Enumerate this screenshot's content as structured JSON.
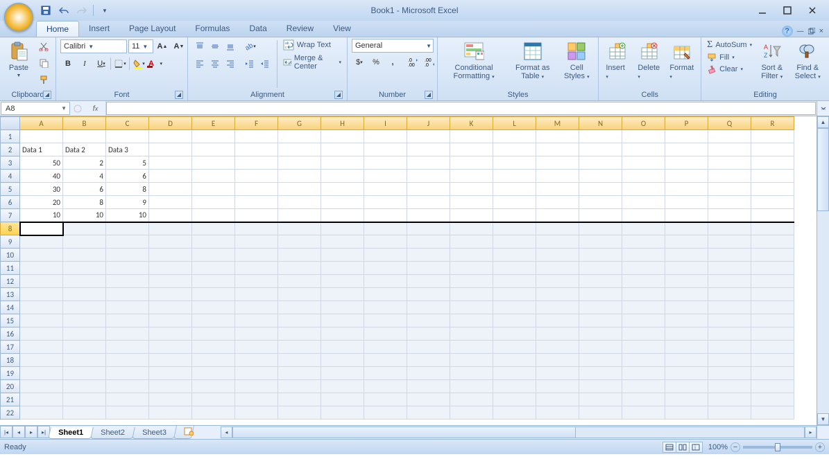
{
  "window": {
    "title": "Book1 - Microsoft Excel"
  },
  "tabs": [
    "Home",
    "Insert",
    "Page Layout",
    "Formulas",
    "Data",
    "Review",
    "View"
  ],
  "active_tab": "Home",
  "ribbon": {
    "clipboard": {
      "label": "Clipboard",
      "paste": "Paste"
    },
    "font": {
      "label": "Font",
      "name": "Calibri",
      "size": "11"
    },
    "alignment": {
      "label": "Alignment",
      "wrap": "Wrap Text",
      "merge": "Merge & Center"
    },
    "number": {
      "label": "Number",
      "format": "General"
    },
    "styles": {
      "label": "Styles",
      "cond": "Conditional Formatting",
      "table": "Format as Table",
      "cell": "Cell Styles"
    },
    "cells": {
      "label": "Cells",
      "insert": "Insert",
      "delete": "Delete",
      "format": "Format"
    },
    "editing": {
      "label": "Editing",
      "autosum": "AutoSum",
      "fill": "Fill",
      "clear": "Clear",
      "sort": "Sort & Filter",
      "find": "Find & Select"
    }
  },
  "namebox": "A8",
  "columns": [
    "A",
    "B",
    "C",
    "D",
    "E",
    "F",
    "G",
    "H",
    "I",
    "J",
    "K",
    "L",
    "M",
    "N",
    "O",
    "P",
    "Q",
    "R"
  ],
  "row_count": 22,
  "active_cell": {
    "row": 8,
    "col": 1
  },
  "chart_data": {
    "type": "table",
    "headers": [
      "Data 1",
      "Data 2",
      "Data 3"
    ],
    "rows": [
      [
        50,
        2,
        5
      ],
      [
        40,
        4,
        6
      ],
      [
        30,
        6,
        8
      ],
      [
        20,
        8,
        9
      ],
      [
        10,
        10,
        10
      ]
    ]
  },
  "cells": {
    "2": {
      "1": "Data 1",
      "2": "Data 2",
      "3": "Data 3"
    },
    "3": {
      "1": "50",
      "2": "2",
      "3": "5"
    },
    "4": {
      "1": "40",
      "2": "4",
      "3": "6"
    },
    "5": {
      "1": "30",
      "2": "6",
      "3": "8"
    },
    "6": {
      "1": "20",
      "2": "8",
      "3": "9"
    },
    "7": {
      "1": "10",
      "2": "10",
      "3": "10"
    }
  },
  "sheets": [
    "Sheet1",
    "Sheet2",
    "Sheet3"
  ],
  "active_sheet": "Sheet1",
  "status": {
    "ready": "Ready",
    "zoom": "100%"
  }
}
